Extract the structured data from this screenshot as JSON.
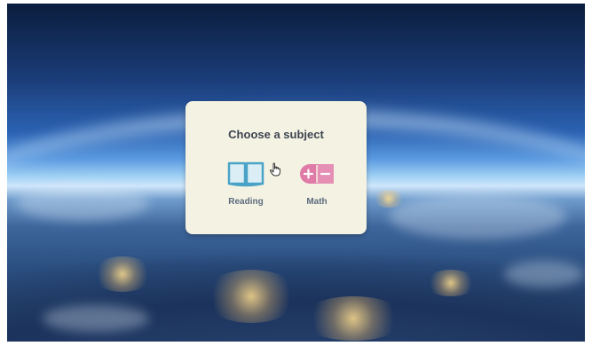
{
  "dialog": {
    "title": "Choose a subject",
    "subjects": [
      {
        "label": "Reading",
        "icon": "book-icon",
        "color": "#4aa3c7"
      },
      {
        "label": "Math",
        "icon": "plus-minus-icon",
        "color": "#e07aa6"
      }
    ]
  },
  "cursor": {
    "icon": "hand-pointer-icon"
  },
  "colors": {
    "dialog_bg": "#f4f3e3",
    "title_text": "#3d4451",
    "label_text": "#5c6b7e",
    "reading_accent": "#4aa3c7",
    "math_accent": "#e07aa6"
  }
}
